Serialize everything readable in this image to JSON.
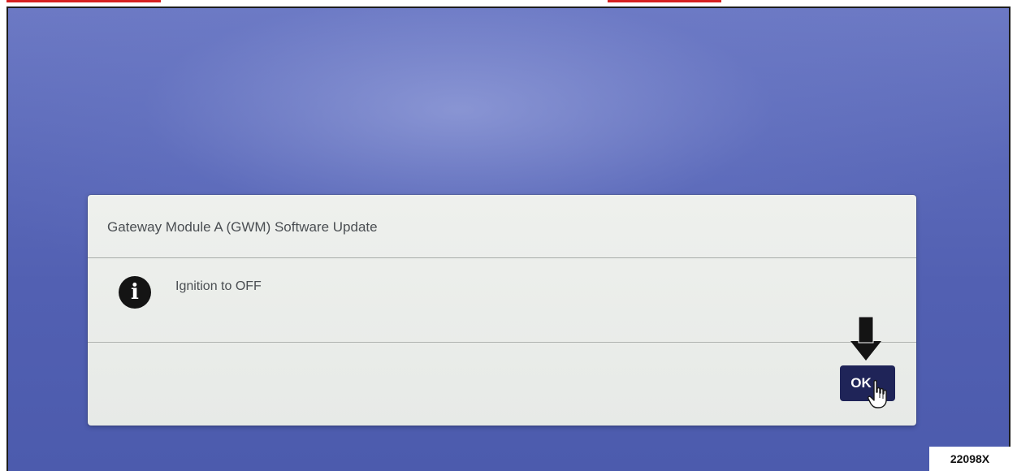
{
  "dialog": {
    "title": "Gateway Module A (GWM) Software Update",
    "message": "Ignition to OFF",
    "message_icon": "info-icon",
    "ok_label": "OK"
  },
  "annotations": {
    "arrow_icon": "down-arrow-icon",
    "cursor_icon": "hand-pointer-icon",
    "figure_code": "22098X"
  },
  "colors": {
    "background": "#5a68b8",
    "dialog": "#eceeeb",
    "ok_button": "#1f2458",
    "accent_strip": "#d62020"
  }
}
